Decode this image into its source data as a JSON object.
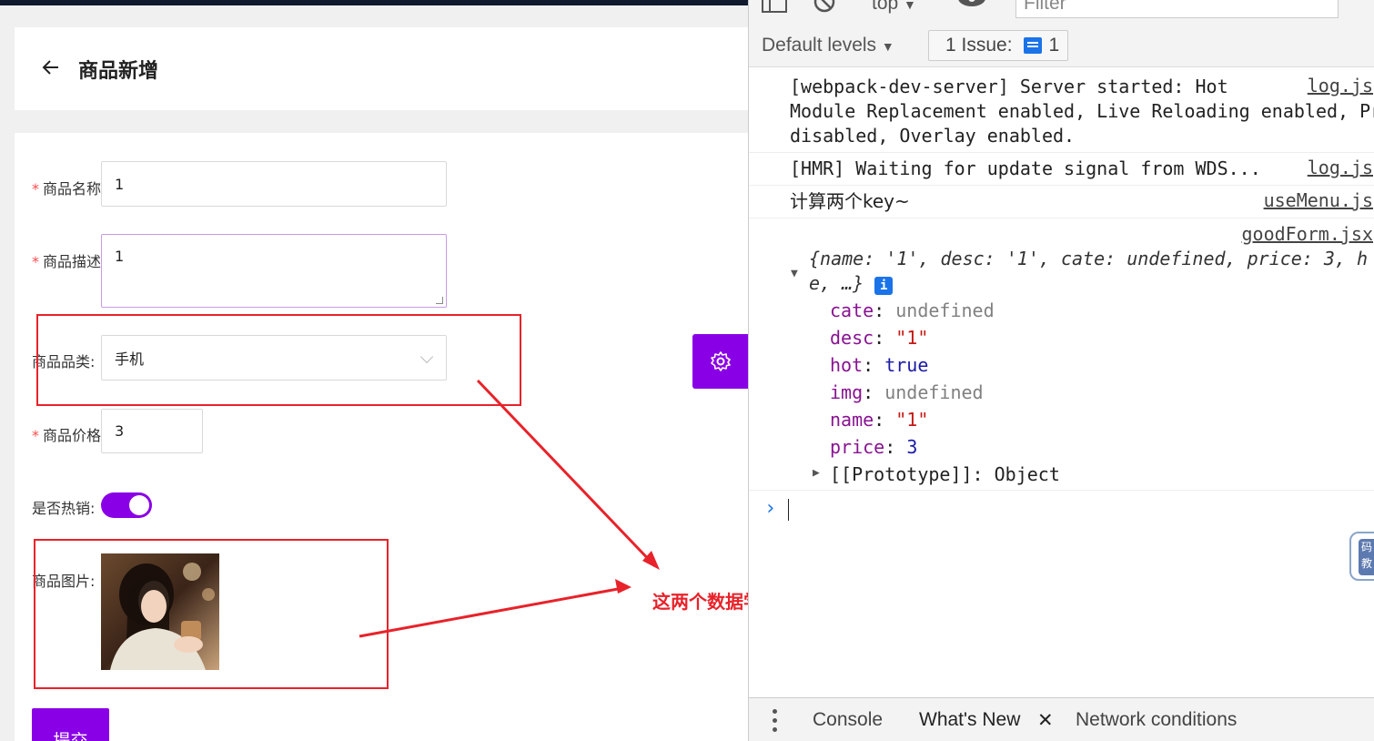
{
  "app": {
    "page_title": "商品新增",
    "form": {
      "name_label": "商品名称",
      "name_value": "1",
      "desc_label": "商品描述",
      "desc_value": "1",
      "cate_label": "商品品类:",
      "cate_value": "手机",
      "price_label": "商品价格",
      "price_value": "3",
      "hot_label": "是否热销:",
      "img_label": "商品图片:",
      "submit_label": "提交"
    },
    "annotation": "这两个数据学没有收集到",
    "accent_color": "#8a00e6",
    "annotation_color": "#e8222a"
  },
  "devtools": {
    "context_label": "top",
    "filter_placeholder": "Filter",
    "levels_label": "Default levels",
    "issues_label": "1 Issue:",
    "issues_count": "1",
    "logs": [
      {
        "text": "[webpack-dev-server] Server started: Hot\nModule Replacement enabled, Live Reloading enabled, Progress\ndisabled, Overlay enabled.",
        "source": "log.js"
      },
      {
        "text": "[HMR] Waiting for update signal from WDS...",
        "source": "log.js"
      },
      {
        "text": "计算两个key~",
        "source": "useMenu.js"
      }
    ],
    "object_log": {
      "source": "goodForm.jsx",
      "summary_line1": "{name: '1', desc: '1', cate: undefined, price: 3, h",
      "summary_line2": "e, …}",
      "props": [
        {
          "key": "cate",
          "value": "undefined",
          "kind": "undef"
        },
        {
          "key": "desc",
          "value": "\"1\"",
          "kind": "str"
        },
        {
          "key": "hot",
          "value": "true",
          "kind": "bool"
        },
        {
          "key": "img",
          "value": "undefined",
          "kind": "undef"
        },
        {
          "key": "name",
          "value": "\"1\"",
          "kind": "str"
        },
        {
          "key": "price",
          "value": "3",
          "kind": "num"
        }
      ],
      "prototype": "[[Prototype]]: Object"
    },
    "bottom_tabs": [
      "Console",
      "What's New",
      "Network conditions"
    ],
    "side_badge": "码\n教"
  }
}
